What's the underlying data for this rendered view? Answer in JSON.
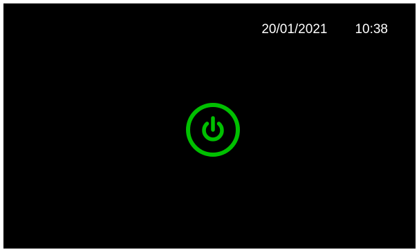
{
  "status_bar": {
    "date": "20/01/2021",
    "time": "10:38"
  },
  "power_button": {
    "icon": "power-icon",
    "color": "#00c000"
  },
  "colors": {
    "background": "#000000",
    "text": "#ffffff",
    "accent": "#00c000"
  }
}
